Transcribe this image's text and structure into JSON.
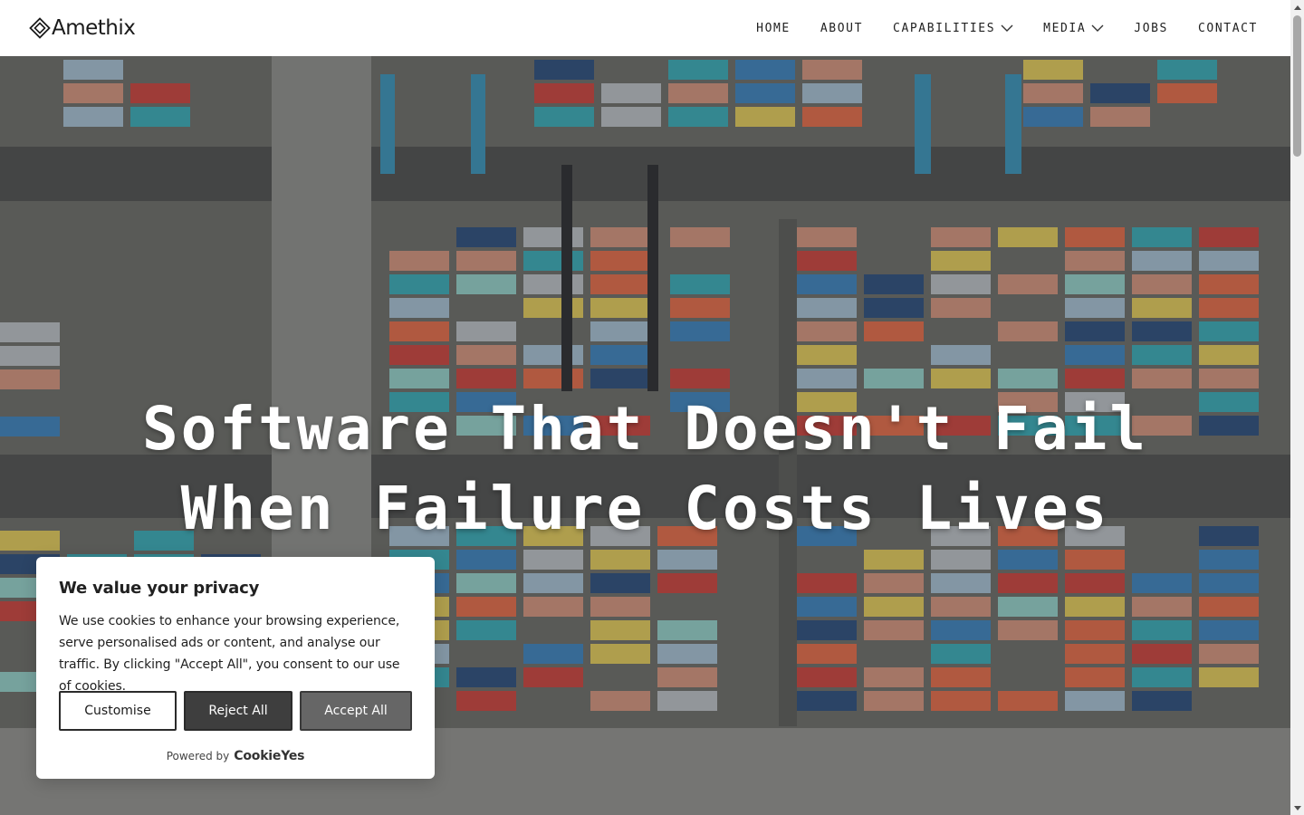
{
  "brand": {
    "name": "Amethix"
  },
  "nav": {
    "items": [
      {
        "label": "HOME"
      },
      {
        "label": "ABOUT"
      },
      {
        "label": "CAPABILITIES"
      },
      {
        "label": "MEDIA"
      },
      {
        "label": "JOBS"
      },
      {
        "label": "CONTACT"
      }
    ]
  },
  "hero": {
    "line1": "Software That Doesn't Fail",
    "line2": "When Failure Costs Lives"
  },
  "cookie": {
    "title": "We value your privacy",
    "body": "We use cookies to enhance your browsing experience, serve personalised ads or content, and analyse our traffic. By clicking \"Accept All\", you consent to our use of cookies.",
    "customise": "Customise",
    "reject": "Reject All",
    "accept": "Accept All",
    "powered_by": "Powered by",
    "powered_brand": "CookieYes"
  },
  "colors": {
    "header_bg": "#ffffff",
    "text_dark": "#222222",
    "reject_bg": "#3e3e3e",
    "accept_bg": "#666666"
  },
  "icons": {
    "logo": "diamond-logo-icon",
    "dropdown": "chevron-down-icon",
    "scroll": "scroll-arrow-icon"
  }
}
